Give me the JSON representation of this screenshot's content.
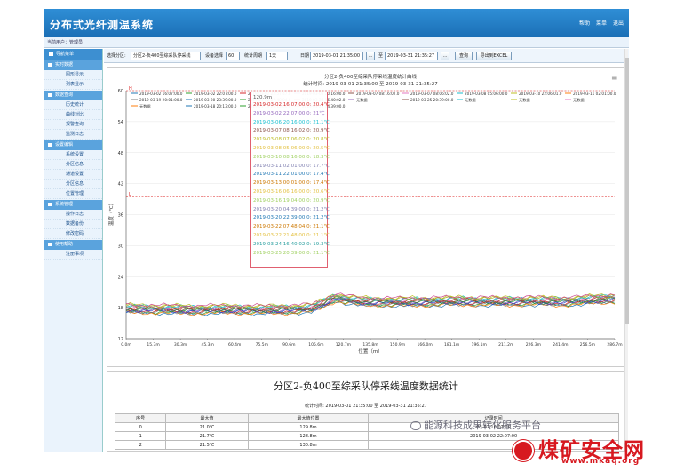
{
  "header": {
    "title": "分布式光纤测温系统",
    "help": "帮助",
    "home": "菜单",
    "logout": "退出"
  },
  "userbar": {
    "text": "当前用户：管理员"
  },
  "sidebar": {
    "top": "导航菜单",
    "groups": [
      {
        "label": "实时数据",
        "items": [
          "图形显示",
          "列表显示"
        ]
      },
      {
        "label": "数据查询",
        "items": [
          "历史统计",
          "曲线对比",
          "报警查询",
          "监测日志"
        ]
      },
      {
        "label": "设置编辑",
        "items": [
          "系统设置",
          "分区信息",
          "通道设置",
          "分区信息",
          "位置管理"
        ]
      },
      {
        "label": "系统管理",
        "items": [
          "操作日志",
          "数据备份",
          "修改密码"
        ]
      },
      {
        "label": "使用帮助",
        "items": [
          "注册事项"
        ]
      }
    ]
  },
  "toolbar": {
    "region_label": "选择分区:",
    "region_value": "分区2-负400至综采队停采线",
    "channel_label": "设备选择",
    "channel_value": "60",
    "period_label": "统计周期",
    "period_value": "1天",
    "date_label": "日期",
    "date_from": "2019-03-01 21:35:00",
    "date_sep": "至",
    "date_to": "2019-03-31 21:35:27",
    "btn_dots": "...",
    "query": "查询",
    "export": "导出到EXCEL"
  },
  "chart_data": {
    "type": "line",
    "title": "分区2-负400至综采队停采线温度统计曲线",
    "subtitle": "统计时间: 2019-03-01 21:35:00 至 2019-03-31 21:35:27",
    "xlabel": "位置（m）",
    "ylabel": "温度（℃）",
    "x_ticks": [
      "0.0m",
      "15.7m",
      "30.3m",
      "45.3m",
      "60.4m",
      "75.5m",
      "90.6m",
      "105.6m",
      "120.7m",
      "135.8m",
      "150.9m",
      "166.0m",
      "181.1m",
      "196.1m",
      "211.2m",
      "226.3m",
      "241.4m",
      "256.5m",
      "286.7m"
    ],
    "y_ticks": [
      12,
      18,
      24,
      30,
      36,
      42,
      48,
      54,
      60
    ],
    "ylim": [
      12,
      60
    ],
    "xlim": [
      0,
      290
    ],
    "alarm_high": {
      "label": "H",
      "value": 60
    },
    "alarm_low": {
      "label": "L",
      "value": 39.5
    },
    "legend": [
      {
        "name": "2019-03-02 16:07:00.0",
        "color": "#1f77b4"
      },
      {
        "name": "2019-03-02 22:07:00.0",
        "color": "#2ca02c"
      },
      {
        "name": "2019-03-02 22:57:47.0",
        "color": "#d62728"
      },
      {
        "name": "2019-03-06 20:16:00.0",
        "color": "#9467bd"
      },
      {
        "name": "2019-03-07 08:16:02.0",
        "color": "#8c564b"
      },
      {
        "name": "2019-03-07 08:06:02.0",
        "color": "#e377c2"
      },
      {
        "name": "2019-03-08 05:06:00.0",
        "color": "#17becf"
      },
      {
        "name": "2019-03-10 22:06:01.0",
        "color": "#bcbd22"
      },
      {
        "name": "2019-03-11 02:01:00.0",
        "color": "#ff7f0e"
      },
      {
        "name": "2019-03-19 20:01:00.0",
        "color": "#7f7f7f"
      },
      {
        "name": "2019-03-20 23:39:00.0",
        "color": "#1f77b4"
      },
      {
        "name": "2019-03-22 07:48:04.0",
        "color": "#2ca02c"
      },
      {
        "name": "2019-03-24 16:40:02.0",
        "color": "#d62728"
      },
      {
        "name": "无数据",
        "color": "#9467bd"
      },
      {
        "name": "2019-03-25 20:39:00.0",
        "color": "#8c564b"
      },
      {
        "name": "无数据",
        "color": "#17becf"
      },
      {
        "name": "无数据",
        "color": "#bcbd22"
      },
      {
        "name": "无数据",
        "color": "#e377c2"
      },
      {
        "name": "无数据",
        "color": "#ff7f0e"
      },
      {
        "name": "2019-03-18 20:13:00.0",
        "color": "#1f77b4"
      },
      {
        "name": "2019-03-19 20:13:00.0",
        "color": "#2ca02c"
      },
      {
        "name": "2019-03-20 04:39:00.0",
        "color": "#d62728"
      }
    ],
    "series_colors": [
      "#1f77b4",
      "#2ca02c",
      "#d62728",
      "#9467bd",
      "#8c564b",
      "#e377c2",
      "#17becf",
      "#bcbd22",
      "#ff7f0e",
      "#7f7f7f",
      "#3344cc",
      "#228844",
      "#aa4422",
      "#44aaaa",
      "#aaaa22",
      "#cc4488"
    ],
    "series_profile": {
      "positions": [
        0,
        20,
        40,
        60,
        80,
        100,
        110,
        118,
        124,
        130,
        140,
        160,
        180,
        200,
        220,
        240,
        260,
        280,
        290
      ],
      "values": [
        17.8,
        17.7,
        17.6,
        17.7,
        17.6,
        17.7,
        17.9,
        19.0,
        20.0,
        19.6,
        19.2,
        19.1,
        19.2,
        19.3,
        19.2,
        19.3,
        19.2,
        19.6,
        19.8
      ]
    }
  },
  "tooltip": {
    "header": "120.9m",
    "rows": [
      {
        "text": "2019-03-02 16:07:00.0: 20.4℃",
        "color": "#d62728"
      },
      {
        "text": "2019-03-02 22:07:00.0: 21℃",
        "color": "#9467bd"
      },
      {
        "text": "2019-03-06 20:16:00.0: 21.1℃",
        "color": "#17becf"
      },
      {
        "text": "2019-03-07 08:16:02.0: 20.9℃",
        "color": "#8c564b"
      },
      {
        "text": "2019-03-08 07:06:02.0: 20.8℃",
        "color": "#bcbd22"
      },
      {
        "text": "2019-03-08 05:06:00.0: 20.5℃",
        "color": "#e3c040"
      },
      {
        "text": "2019-03-10 08:16:00.0: 18.3℃",
        "color": "#9fd060"
      },
      {
        "text": "2019-03-11 02:01:00.0: 17.7℃",
        "color": "#7f7fb0"
      },
      {
        "text": "2019-03-11 22:01:00.0: 17.4℃",
        "color": "#1f77b4"
      },
      {
        "text": "2019-03-13 00:01:00.0: 17.4℃",
        "color": "#cc7700"
      },
      {
        "text": "2019-03-16 06:16:00.0: 20.6℃",
        "color": "#e3c040"
      },
      {
        "text": "2019-03-16 19:04:00.0: 20.9℃",
        "color": "#9fd060"
      },
      {
        "text": "2019-03-20 04:39:00.0: 21.2℃",
        "color": "#7f7fb0"
      },
      {
        "text": "2019-03-20 22:39:00.0: 21.2℃",
        "color": "#1f77b4"
      },
      {
        "text": "2019-03-22 07:48:04.0: 21.1℃",
        "color": "#cc7700"
      },
      {
        "text": "2019-03-22 21:48:00.0: 21.1℃",
        "color": "#e3c040"
      },
      {
        "text": "2019-03-24 16:40:02.0: 19.3℃",
        "color": "#2ca0a0"
      },
      {
        "text": "2019-03-25 20:39:00.0: 21.1℃",
        "color": "#9fd060"
      }
    ]
  },
  "stats": {
    "title": "分区2-负400至综采队停采线温度数据统计",
    "time": "统计时间: 2019-03-01 21:35:00 至 2019-03-31 21:35:27",
    "columns": [
      "序号",
      "最大值",
      "最大值位置",
      "记录时间"
    ],
    "rows": [
      [
        "0",
        "21.0℃",
        "129.8m",
        "03-02 16:07:00"
      ],
      [
        "1",
        "21.7℃",
        "128.8m",
        "2019-03-02 22:07:00"
      ],
      [
        "2",
        "21.5℃",
        "130.8m",
        ""
      ]
    ]
  },
  "watermark": "能源科技成果转化服务平台",
  "logo": {
    "text": "煤矿安全网",
    "url": "www.mkaq.org"
  }
}
